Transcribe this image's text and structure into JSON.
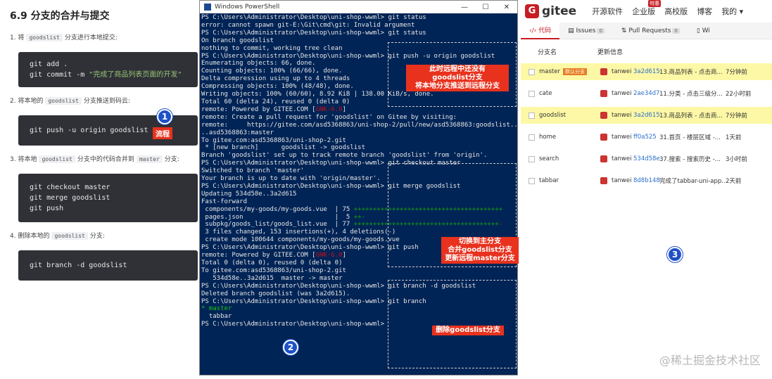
{
  "doc": {
    "title": "6.9 分支的合并与提交",
    "steps": [
      {
        "num": "1.",
        "pre": "将",
        "code": "goodslist",
        "post": "分支进行本地提交:"
      },
      {
        "num": "2.",
        "pre": "将本地的",
        "code": "goodslist",
        "post": "分支推送到码云:"
      },
      {
        "num": "3.",
        "pre": "将本地",
        "code": "goodslist",
        "post": "分支中的代码合并到",
        "code2": "master",
        "post2": "分支:"
      },
      {
        "num": "4.",
        "pre": "删除本地的",
        "code": "goodslist",
        "post": "分支:"
      }
    ],
    "block1_l1": "git add .",
    "block1_l2_cmd": "git commit -m ",
    "block1_l2_str": "\"完成了商品列表页面的开发\"",
    "block2": "git push -u origin goodslist",
    "block3": [
      "git checkout master",
      "git merge goodslist",
      "git push"
    ],
    "block4": "git branch -d goodslist",
    "marker1": "1",
    "tag_flow": "流程"
  },
  "ps": {
    "window_title": "Windows PowerShell",
    "min": "—",
    "max": "☐",
    "close": "✕",
    "marker2": "2",
    "notes": {
      "n1": "此时远程中还没有\ngoodslist分支\n将本地分支推送到远程分支",
      "n2": "切换到主分支\n合并goodslist分支\n更新远程master分支",
      "n3": "删除goodslist分支"
    }
  },
  "gitee": {
    "brand": "gitee",
    "nav": [
      "开源软件",
      "企业版",
      "高校版",
      "博客",
      "我的 ▾"
    ],
    "badge": "特惠",
    "tabs": [
      {
        "label": "代码",
        "count": ""
      },
      {
        "label": "Issues",
        "count": "0"
      },
      {
        "label": "Pull Requests",
        "count": "0"
      },
      {
        "label": "Wi",
        "count": ""
      }
    ],
    "col_branch": "分支名",
    "col_update": "更新信息",
    "default_badge": "默认分支",
    "branches": [
      {
        "name": "master",
        "author": "tanwei",
        "sha": "3a2d615",
        "msg": "13.商品列表 - 点击商...",
        "time": "7分钟前"
      },
      {
        "name": "cate",
        "author": "tanwei",
        "sha": "2ae34d7",
        "msg": "11.分类 - 点击三级分...",
        "time": "22小时前"
      },
      {
        "name": "goodslist",
        "author": "tanwei",
        "sha": "3a2d615",
        "msg": "13.商品列表 - 点击商...",
        "time": "7分钟前"
      },
      {
        "name": "home",
        "author": "tanwei",
        "sha": "ff0a525",
        "msg": "31.首页 - 楼层区域 -...",
        "time": "1天前"
      },
      {
        "name": "search",
        "author": "tanwei",
        "sha": "534d58e",
        "msg": "37.搜索 - 搜索历史 -...",
        "time": "3小时前"
      },
      {
        "name": "tabbar",
        "author": "tanwei",
        "sha": "8d8b148",
        "msg": "完成了tabbar-uni-app...",
        "time": "2天前"
      }
    ],
    "marker3": "3"
  },
  "watermark": "@稀土掘金技术社区"
}
